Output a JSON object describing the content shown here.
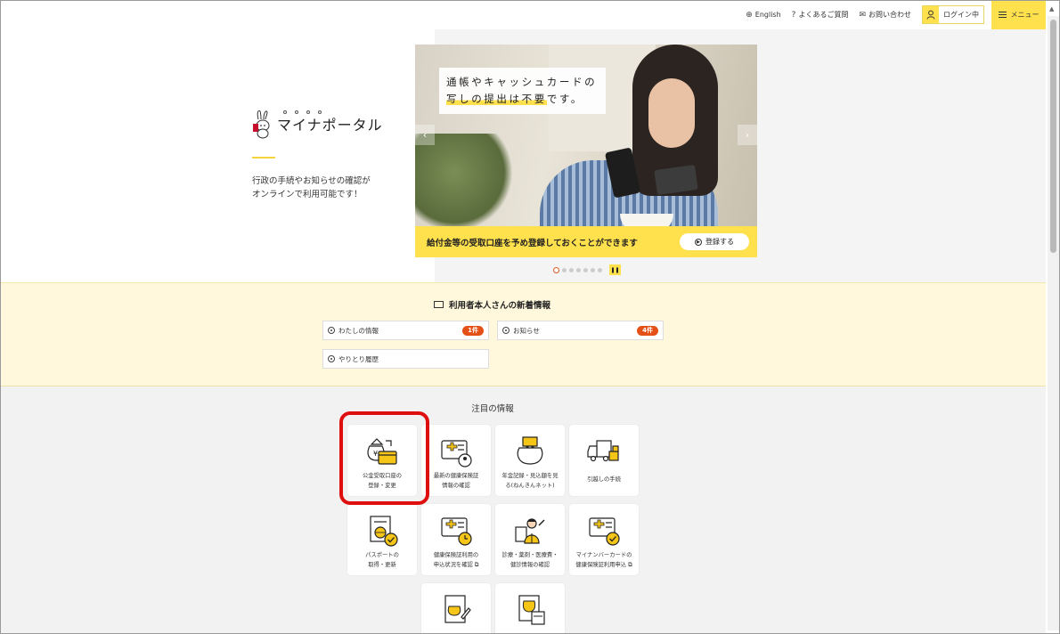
{
  "topnav": {
    "english": "English",
    "faq": "よくあるご質問",
    "contact": "お問い合わせ",
    "login": "ログイン中",
    "menu": "メニュー"
  },
  "brand": {
    "logo_text": "マイナポータル",
    "tagline_line1": "行政の手続やお知らせの確認が",
    "tagline_line2": "オンラインで利用可能です！"
  },
  "carousel": {
    "bubble_line1": "通帳やキャッシュカードの",
    "bubble_line2_hl": "写しの提出は不要",
    "bubble_line2_rest": "です。",
    "caption": "給付金等の受取口座を予め登録しておくことができます",
    "register_label": "登録する",
    "slide_count": 7,
    "active_slide": 1,
    "prev_icon": "chevron-left-icon",
    "next_icon": "chevron-right-icon"
  },
  "news": {
    "title": "利用者本人さんの新着情報",
    "items": [
      {
        "label": "わたしの情報",
        "badge": "1件"
      },
      {
        "label": "お知らせ",
        "badge": "4件"
      },
      {
        "label": "やりとり履歴",
        "badge": ""
      }
    ]
  },
  "featured": {
    "title": "注目の情報",
    "tiles": [
      {
        "line1": "公金受取口座の",
        "line2": "登録・変更",
        "icon": "money-bag-card-icon"
      },
      {
        "line1": "最新の健康保険証",
        "line2": "情報の確認",
        "icon": "health-card-icon"
      },
      {
        "line1": "年金記録・見込額を見",
        "line2": "る(ねんきんネット)",
        "icon": "pension-purse-icon"
      },
      {
        "line1": "引越しの手続",
        "line2": "",
        "icon": "moving-truck-icon"
      },
      {
        "line1": "パスポートの",
        "line2": "取得・更新",
        "icon": "passport-icon"
      },
      {
        "line1": "健康保険証利用の",
        "line2": "申込状況を確認",
        "icon": "health-card-clock-icon"
      },
      {
        "line1": "診療・薬剤・医療費・",
        "line2": "健診情報の確認",
        "icon": "doctor-icon"
      },
      {
        "line1": "マイナンバーカードの",
        "line2": "健康保険証利用申込",
        "icon": "health-card-check-icon"
      },
      {
        "line1": "",
        "line2": "",
        "icon": "document-purse-icon"
      },
      {
        "line1": "",
        "line2": "",
        "icon": "money-calculator-icon"
      }
    ]
  },
  "colors": {
    "brand_yellow": "#ffe14d",
    "badge_orange": "#e55016",
    "highlight_red": "#e00f0f",
    "news_bg": "#fff8dc"
  }
}
